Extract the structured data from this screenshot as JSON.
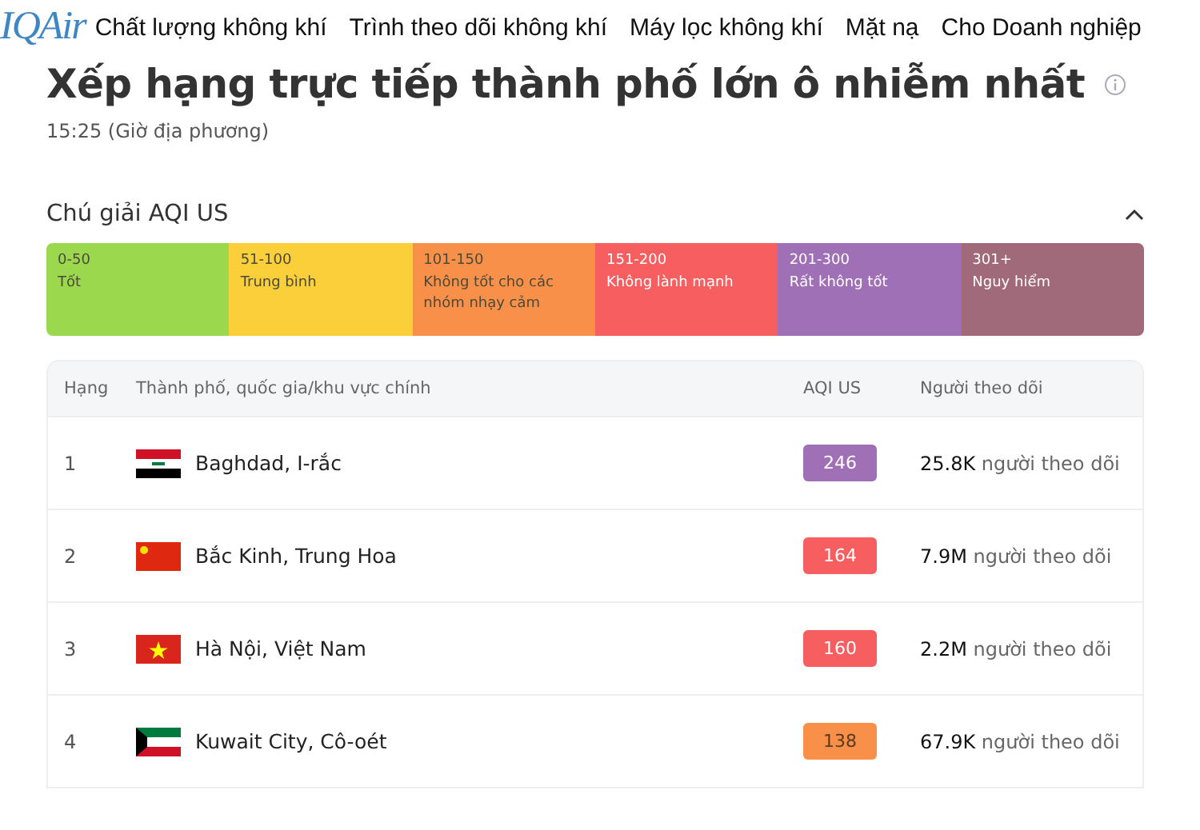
{
  "nav": {
    "logo": "IQAir",
    "items": [
      "Chất lượng không khí",
      "Trình theo dõi không khí",
      "Máy lọc không khí",
      "Mặt nạ",
      "Cho Doanh nghiệp"
    ]
  },
  "title": "Xếp hạng trực tiếp thành phố lớn ô nhiễm nhất",
  "time": "15:25 (Giờ địa phương)",
  "legend": {
    "heading": "Chú giải AQI US",
    "expanded": true,
    "items": [
      {
        "range": "0-50",
        "label": "Tốt",
        "color": "#9cd84e"
      },
      {
        "range": "51-100",
        "label": "Trung bình",
        "color": "#facf39"
      },
      {
        "range": "101-150",
        "label": "Không tốt cho các nhóm nhạy cảm",
        "color": "#f99049"
      },
      {
        "range": "151-200",
        "label": "Không lành mạnh",
        "color": "#f65e5f"
      },
      {
        "range": "201-300",
        "label": "Rất không tốt",
        "color": "#a070b6"
      },
      {
        "range": "301+",
        "label": "Nguy hiểm",
        "color": "#a06a7b"
      }
    ]
  },
  "table": {
    "columns": [
      "Hạng",
      "Thành phố, quốc gia/khu vực chính",
      "AQI US",
      "Người theo dõi"
    ],
    "rows": [
      {
        "rank": "1",
        "kind": "iraq",
        "city": "Baghdad, I-rắc",
        "aqi": "246",
        "color": "#a070b6",
        "followers": "25.8K",
        "followers_label": "người theo dõi"
      },
      {
        "rank": "2",
        "kind": "china",
        "city": "Bắc Kinh, Trung Hoa",
        "aqi": "164",
        "color": "#f65e5f",
        "followers": "7.9M",
        "followers_label": "người theo dõi"
      },
      {
        "rank": "3",
        "kind": "vietnam",
        "city": "Hà Nội, Việt Nam",
        "aqi": "160",
        "color": "#f65e5f",
        "followers": "2.2M",
        "followers_label": "người theo dõi"
      },
      {
        "rank": "4",
        "kind": "kuwait",
        "city": "Kuwait City, Cô-oét",
        "aqi": "138",
        "color": "#f99049",
        "followers": "67.9K",
        "followers_label": "người theo dõi"
      }
    ]
  }
}
